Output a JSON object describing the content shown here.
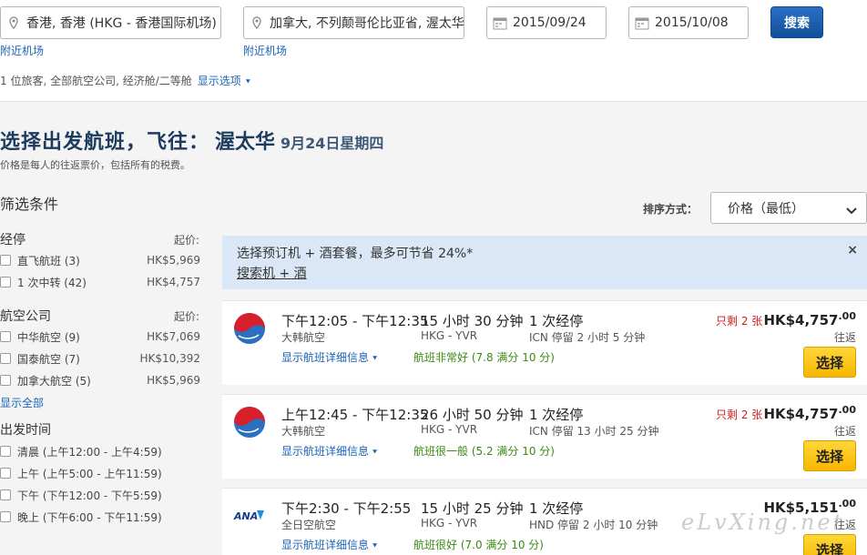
{
  "search": {
    "origin": "香港, 香港 (HKG - 香港国际机场)",
    "destination": "加拿大, 不列颠哥伦比亚省, 渥太华",
    "depart_date": "2015/09/24",
    "return_date": "2015/10/08",
    "nearby_origin": "附近机场",
    "nearby_dest": "附近机场",
    "search_button": "搜索",
    "summary": "1 位旅客, 全部航空公司, 经济舱/二等舱",
    "show_options": "显示选项"
  },
  "heading": {
    "title": "选择出发航班，飞往：",
    "city": "渥太华",
    "date": "9月24日星期四",
    "price_note": "价格是每人的往返票价，包括所有的税费。"
  },
  "filters": {
    "title": "筛选条件",
    "stops": {
      "title": "经停",
      "from_label": "起价:",
      "items": [
        {
          "label": "直飞航班 (3)",
          "price": "HK$5,969"
        },
        {
          "label": "1 次中转 (42)",
          "price": "HK$4,757"
        }
      ]
    },
    "airlines": {
      "title": "航空公司",
      "from_label": "起价:",
      "items": [
        {
          "label": "中华航空 (9)",
          "price": "HK$7,069"
        },
        {
          "label": "国泰航空 (7)",
          "price": "HK$10,392"
        },
        {
          "label": "加拿大航空 (5)",
          "price": "HK$5,969"
        }
      ]
    },
    "show_all": "显示全部",
    "departure": {
      "title": "出发时间",
      "items": [
        {
          "label": "清晨 (上午12:00 - 上午4:59)"
        },
        {
          "label": "上午 (上午5:00 - 上午11:59)"
        },
        {
          "label": "下午 (下午12:00 - 下午5:59)"
        },
        {
          "label": "晚上 (下午6:00 - 下午11:59)"
        }
      ]
    }
  },
  "sort": {
    "label": "排序方式：",
    "value": "价格（最低）"
  },
  "promo": {
    "text": "选择预订机 + 酒套餐，最多可节省 24%*",
    "link": "搜索机 + 酒",
    "close": "×"
  },
  "flights": [
    {
      "times": "下午12:05 - 下午12:35",
      "airline": "大韩航空",
      "duration": "15 小时 30 分钟",
      "route": "HKG - YVR",
      "stops": "1 次经停",
      "stop_info": "ICN 停留 2 小时 5 分钟",
      "details": "显示航班详细信息",
      "rating": "航班非常好 (7.8 满分 10 分)",
      "seats": "只剩 2 张",
      "price": "HK$4,757",
      "cents": ".00",
      "trip": "往返",
      "select": "选择"
    },
    {
      "times": "上午12:45 - 下午12:35",
      "airline": "大韩航空",
      "duration": "26 小时 50 分钟",
      "route": "HKG - YVR",
      "stops": "1 次经停",
      "stop_info": "ICN 停留 13 小时 25 分钟",
      "details": "显示航班详细信息",
      "rating": "航班很一般 (5.2 满分 10 分)",
      "seats": "只剩 2 张",
      "price": "HK$4,757",
      "cents": ".00",
      "trip": "往返",
      "select": "选择"
    },
    {
      "times": "下午2:30 - 下午2:55",
      "airline": "全日空航空",
      "duration": "15 小时 25 分钟",
      "route": "HKG - YVR",
      "stops": "1 次经停",
      "stop_info": "HND 停留 2 小时 10 分钟",
      "details": "显示航班详细信息",
      "rating": "航班很好 (7.0 满分 10 分)",
      "seats": "",
      "price": "HK$5,151",
      "cents": ".00",
      "trip": "往返",
      "select": "选择"
    }
  ],
  "watermark": "eLvXing.net",
  "ana_logo_text": "ANA"
}
